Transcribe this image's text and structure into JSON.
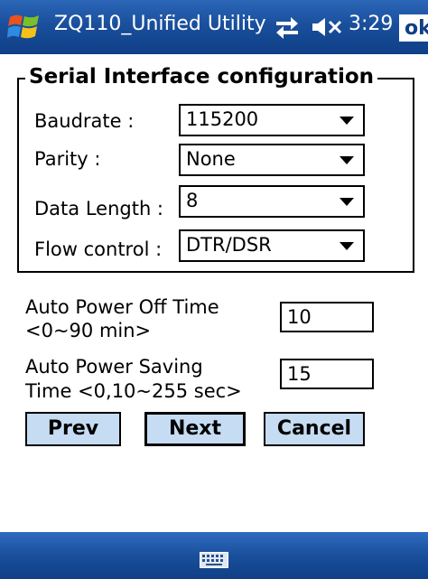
{
  "titlebar": {
    "title": "ZQ110_Unified Utility",
    "time": "3:29",
    "ok_label": "ok",
    "icons": [
      "windows-start-icon",
      "sync-icon",
      "volume-muted-icon"
    ]
  },
  "group": {
    "title": "Serial Interface configuration",
    "baudrate": {
      "label": "Baudrate :",
      "value": "115200"
    },
    "parity": {
      "label": "Parity :",
      "value": "None"
    },
    "data_length": {
      "label": "Data Length :",
      "value": "8"
    },
    "flow_control": {
      "label": "Flow control :",
      "value": "DTR/DSR"
    }
  },
  "auto_power_off": {
    "label_line1": "Auto Power Off Time",
    "label_line2": "<0~90 min>",
    "value": "10"
  },
  "auto_power_saving": {
    "label_line1": "Auto Power Saving",
    "label_line2": "Time <0,10~255 sec>",
    "value": "15"
  },
  "buttons": {
    "prev": "Prev",
    "next": "Next",
    "cancel": "Cancel"
  },
  "bottombar": {
    "icons": [
      "keyboard-icon"
    ]
  }
}
